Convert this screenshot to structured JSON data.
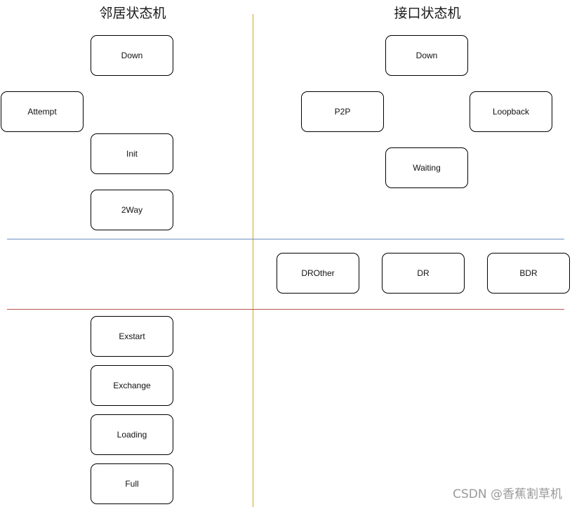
{
  "titles": {
    "neighbor": "邻居状态机",
    "interface": "接口状态机"
  },
  "neighbor_states": [
    "Down",
    "Attempt",
    "Init",
    "2Way",
    "Exstart",
    "Exchange",
    "Loading",
    "Full"
  ],
  "interface_states": [
    "Down",
    "P2P",
    "Loopback",
    "Waiting"
  ],
  "dr_roles": [
    "DROther",
    "DR",
    "BDR"
  ],
  "dividers": {
    "vertical_color": "#d1a520",
    "upper_horizontal_color": "#6c8ebf",
    "lower_horizontal_color": "#b85450"
  },
  "watermark": "CSDN @香蕉割草机"
}
